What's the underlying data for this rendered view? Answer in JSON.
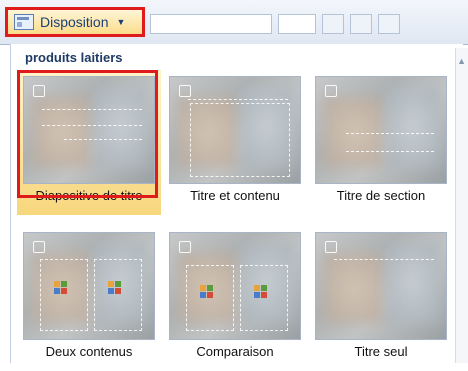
{
  "ribbon": {
    "disposition_label": "Disposition",
    "dropdown_glyph": "▼"
  },
  "gallery": {
    "section_title": "produits laitiers",
    "layouts": [
      {
        "label": "Diapositive de titre",
        "selected": true
      },
      {
        "label": "Titre et contenu",
        "selected": false
      },
      {
        "label": "Titre de section",
        "selected": false
      },
      {
        "label": "Deux contenus",
        "selected": false
      },
      {
        "label": "Comparaison",
        "selected": false
      },
      {
        "label": "Titre seul",
        "selected": false
      }
    ]
  },
  "colors": {
    "highlight": "#e01b1b",
    "selected_tile": "#f7d77d",
    "ribbon_text": "#1b3f78"
  },
  "icons": {
    "layout_icon": "slide-layout-icon",
    "scroll_up": "scroll-up-arrow-icon"
  }
}
